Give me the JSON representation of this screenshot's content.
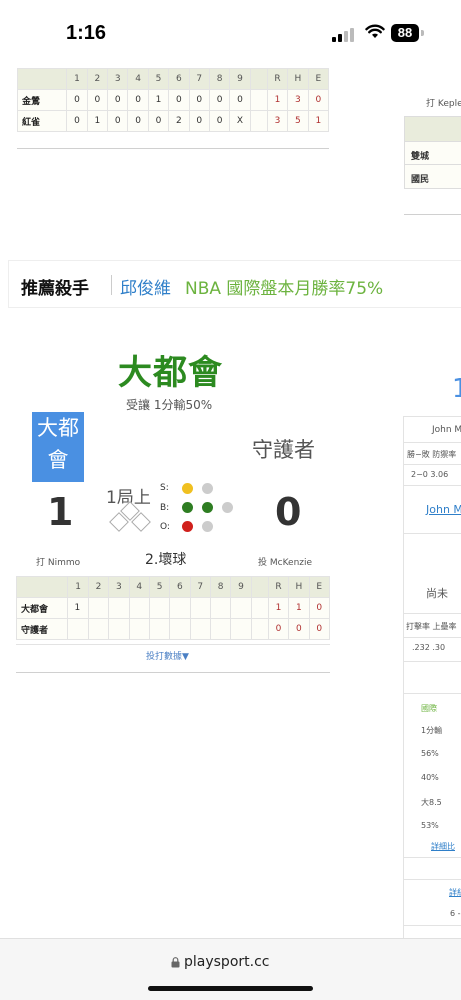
{
  "status": {
    "time": "1:16",
    "battery": "88"
  },
  "box_columns": [
    "1",
    "2",
    "3",
    "4",
    "5",
    "6",
    "7",
    "8",
    "9",
    "R",
    "H",
    "E"
  ],
  "game1": {
    "rows": [
      {
        "team": "金鶯",
        "innings": [
          "0",
          "0",
          "0",
          "0",
          "1",
          "0",
          "0",
          "0",
          "0"
        ],
        "rhe": [
          "1",
          "3",
          "0"
        ]
      },
      {
        "team": "紅雀",
        "innings": [
          "0",
          "1",
          "0",
          "0",
          "0",
          "2",
          "0",
          "0",
          "X"
        ],
        "rhe": [
          "3",
          "5",
          "1"
        ]
      }
    ]
  },
  "right_partial": {
    "batter_fragment": "打 Keple",
    "teams": [
      "雙城",
      "國民"
    ],
    "pitcher_fragment": "John M",
    "stat_headers": "勝−敗 防禦率",
    "stat_values": "2−0 3.06",
    "pitcher_link": "John M",
    "not_yet": "尚未",
    "bat_headers": "打擊率 上壘率",
    "bat_values": ".232 .30",
    "market_header": "國際",
    "market_rows": [
      "1分輸",
      "56%",
      "40%",
      "大8.5",
      "53%"
    ],
    "detail_link": "詳細比",
    "detail_link2": "詳紅",
    "last_value": "6 -"
  },
  "promo": {
    "title": "推薦殺手",
    "name": "邱俊維",
    "text": "NBA 國際盤本月勝率75%"
  },
  "live": {
    "away_big": "大都會",
    "handicap": "受讓 1分輸50%",
    "away_box_line1": "大都",
    "away_box_line2": "會",
    "home_name": "守護者",
    "away_score": "1",
    "home_score": "0",
    "inning": "1局上",
    "count_labels": [
      "S:",
      "B:",
      "O:"
    ],
    "outs_text": "2.壞球",
    "batter": "打 Nimmo",
    "pitcher": "投 McKenzie",
    "rows": [
      {
        "team": "大都會",
        "innings": [
          "1",
          "",
          "",
          "",
          "",
          "",
          "",
          "",
          ""
        ],
        "rhe": [
          "1",
          "1",
          "0"
        ]
      },
      {
        "team": "守護者",
        "innings": [
          "",
          "",
          "",
          "",
          "",
          "",
          "",
          "",
          ""
        ],
        "rhe": [
          "0",
          "0",
          "0"
        ]
      }
    ],
    "pitch_link": "投打數據▼",
    "count_colors": {
      "strike": "#f0c020",
      "ball": "#2e7d22",
      "out": "#d0201c",
      "empty": "#cccccc"
    }
  },
  "url": "playsport.cc"
}
